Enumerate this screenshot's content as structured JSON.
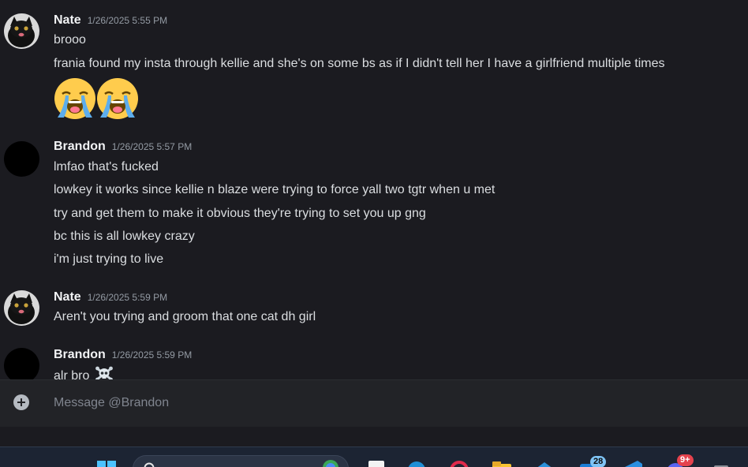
{
  "conversation": {
    "messages": [
      {
        "author": "Nate",
        "timestamp": "1/26/2025 5:55 PM",
        "lines": [
          "brooo",
          "frania found my insta through kellie and she's on some bs as if I didn't tell her I have a girlfriend multiple times"
        ],
        "emoji": [
          "loudly-crying-face",
          "loudly-crying-face"
        ]
      },
      {
        "author": "Brandon",
        "timestamp": "1/26/2025 5:57 PM",
        "lines": [
          "lmfao that's fucked",
          "lowkey it works since kellie n blaze were trying to force yall two tgtr when u met",
          "try and get them to make it obvious they're trying to set you up gng",
          "bc this is all lowkey crazy",
          "i'm just trying to live"
        ]
      },
      {
        "author": "Nate",
        "timestamp": "1/26/2025 5:59 PM",
        "lines": [
          "Aren't you trying  and groom that one cat dh girl"
        ]
      },
      {
        "author": "Brandon",
        "timestamp": "1/26/2025 5:59 PM",
        "lines": [
          "alr bro"
        ],
        "trailing_emoji": "skull-and-crossbones"
      }
    ]
  },
  "composer": {
    "placeholder": "Message @Brandon",
    "value": ""
  },
  "taskbar": {
    "badges": {
      "mail_count": "28",
      "discord_count": "9+"
    }
  },
  "colors": {
    "chat_bg": "#1b1b20",
    "composer_bg": "#222327",
    "author": "#f2f3f5",
    "timestamp": "#949ba4",
    "text": "#dbdee1",
    "taskbar_bg": "#1c2433"
  }
}
